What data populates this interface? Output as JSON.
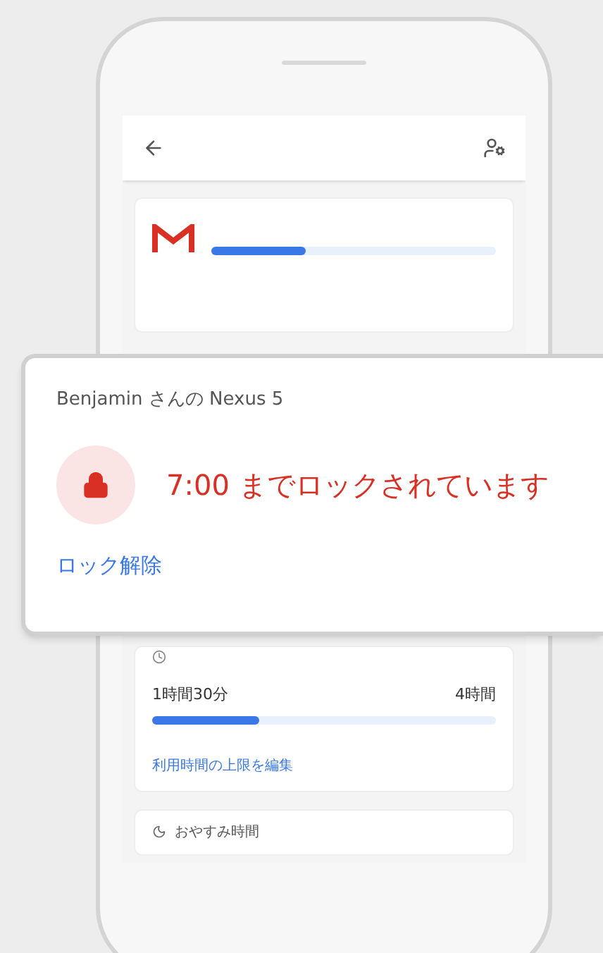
{
  "app_usage": {
    "level": 0.33
  },
  "limit_card": {
    "used": "1時間30分",
    "limit": "4時間",
    "level": 0.31,
    "edit_link": "利用時間の上限を編集"
  },
  "bedtime_card": {
    "title": "おやすみ時間"
  },
  "lock_notice": {
    "device": "Benjamin さんの Nexus 5",
    "message": "7:00 までロックされています",
    "unlock_link": "ロック解除"
  }
}
